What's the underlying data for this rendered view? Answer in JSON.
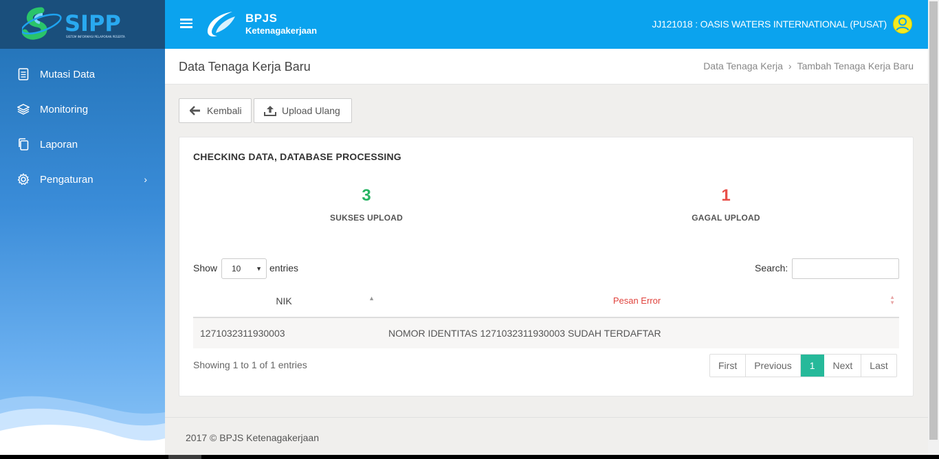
{
  "brand": {
    "logo_text": "SIPP",
    "tagline": "SISTEM INFORMASI PELAPORAN PESERTA"
  },
  "sidebar": {
    "items": [
      {
        "label": "Mutasi Data",
        "icon": "document-icon"
      },
      {
        "label": "Monitoring",
        "icon": "layers-icon"
      },
      {
        "label": "Laporan",
        "icon": "copy-icon"
      },
      {
        "label": "Pengaturan",
        "icon": "gear-icon",
        "chevron": "›"
      }
    ]
  },
  "topbar": {
    "org_name": "BPJS",
    "org_sub": "Ketenagakerjaan",
    "company": "JJ121018 : OASIS WATERS INTERNATIONAL (PUSAT)"
  },
  "header": {
    "title": "Data Tenaga Kerja Baru",
    "breadcrumb": [
      "Data Tenaga Kerja",
      "Tambah Tenaga Kerja Baru"
    ],
    "separator": "›"
  },
  "actions": {
    "back_label": "Kembali",
    "upload_label": "Upload Ulang"
  },
  "card": {
    "title": "CHECKING DATA, DATABASE PROCESSING",
    "success_count": "3",
    "success_label": "SUKSES UPLOAD",
    "fail_count": "1",
    "fail_label": "GAGAL UPLOAD"
  },
  "table": {
    "show_label": "Show",
    "entries_value": "10",
    "entries_label": "entries",
    "search_label": "Search:",
    "columns": [
      "NIK",
      "Pesan Error"
    ],
    "rows": [
      [
        "1271032311930003",
        "NOMOR IDENTITAS 1271032311930003 SUDAH TERDAFTAR"
      ]
    ],
    "info": "Showing 1 to 1 of 1 entries",
    "pagination": [
      "First",
      "Previous",
      "1",
      "Next",
      "Last"
    ]
  },
  "footer": {
    "text": "2017 © BPJS Ketenagakerjaan"
  },
  "colors": {
    "topbar": "#0ba3ee",
    "success": "#27b463",
    "error": "#e8504a",
    "active_page": "#26b99a"
  }
}
